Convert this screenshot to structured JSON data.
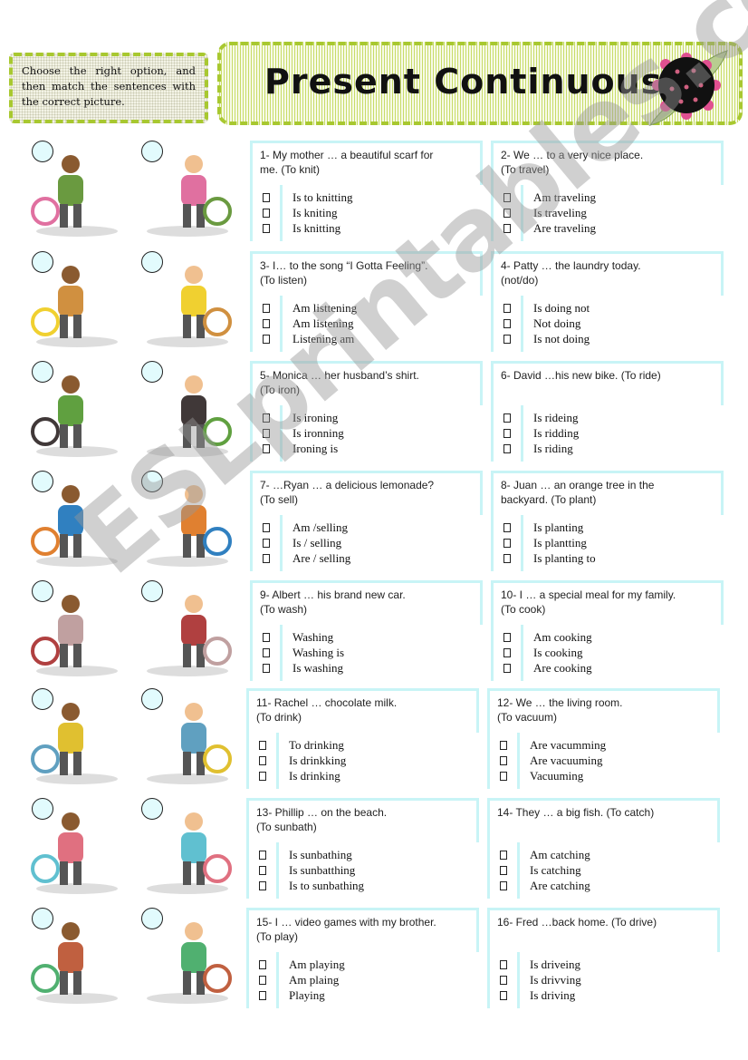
{
  "header": {
    "instructions": "Choose the right option, and then match the sentences with the correct picture.",
    "title": "Present Continuous",
    "accent_color": "#a8c830",
    "box_border_color": "#c8f4f6"
  },
  "watermark": "ESLprintables.com",
  "pictures": [
    [
      "boy-riding-bike",
      "girl-with-binoculars"
    ],
    [
      "boy-planting-tree",
      "woman-sunbathing"
    ],
    [
      "men-catching-fish",
      "boys-playing-video-games"
    ],
    [
      "boy-selling-lemonade",
      "woman-knitting"
    ],
    [
      "woman-ironing",
      "woman-vacuuming"
    ],
    [
      "laundry-basket-girl",
      "car-travel"
    ],
    [
      "woman-cooking",
      "car-with-luggage"
    ],
    [
      "boy-listening-music",
      "man-washing-car"
    ]
  ],
  "questions": [
    {
      "lines": [
        "1- My mother … a beautiful scarf for",
        "me. (To knit)"
      ],
      "options": [
        "Is to knitting",
        "Is kniting",
        "Is knitting"
      ]
    },
    {
      "lines": [
        "2-  We … to a very nice place.",
        "(To travel)"
      ],
      "options": [
        "Am traveling",
        "Is traveling",
        "Are traveling"
      ]
    },
    {
      "lines": [
        "3- I… to the song  “I Gotta Feeling”.",
        "(To listen)"
      ],
      "options": [
        "Am listtening",
        "Am listening",
        "Listening am"
      ]
    },
    {
      "lines": [
        "4- Patty … the laundry today.",
        "(not/do)"
      ],
      "options": [
        "Is doing not",
        "Not doing",
        "Is not doing"
      ]
    },
    {
      "lines": [
        "5-  Monica … her husband’s shirt.",
        "(To iron)"
      ],
      "options": [
        "Is ironing",
        "Is ironning",
        "Ironing is"
      ]
    },
    {
      "lines": [
        "6- David …his new bike. (To ride)",
        ""
      ],
      "options": [
        "Is rideing",
        "Is ridding",
        "Is riding"
      ]
    },
    {
      "lines": [
        "7- …Ryan … a delicious lemonade?",
        "(To sell)"
      ],
      "options": [
        "Am /selling",
        "Is / selling",
        "Are / selling"
      ]
    },
    {
      "lines": [
        "8- Juan … an orange tree in the",
        "backyard. (To plant)"
      ],
      "options": [
        "Is planting",
        "Is plantting",
        "Is planting to"
      ]
    },
    {
      "lines": [
        "9- Albert … his brand new car.",
        "(To wash)"
      ],
      "options": [
        "Washing",
        "Washing is",
        "Is washing"
      ]
    },
    {
      "lines": [
        "10- I … a special meal for my family.",
        "(To cook)"
      ],
      "options": [
        "Am cooking",
        "Is cooking",
        "Are cooking"
      ]
    },
    {
      "lines": [
        "11- Rachel … chocolate milk.",
        "(To drink)"
      ],
      "options": [
        "To drinking",
        "Is drinkking",
        "Is drinking"
      ]
    },
    {
      "lines": [
        "12- We … the living room.",
        "(To vacuum)"
      ],
      "options": [
        "Are vacumming",
        "Are vacuuming",
        "Vacuuming"
      ]
    },
    {
      "lines": [
        "13-  Phillip … on the beach.",
        "(To sunbath)"
      ],
      "options": [
        "Is sunbathing",
        "Is sunbatthing",
        "Is to sunbathing"
      ]
    },
    {
      "lines": [
        "14- They … a big fish. (To catch)",
        ""
      ],
      "options": [
        "Am catching",
        "Is catching",
        "Are catching"
      ]
    },
    {
      "lines": [
        "15- I … video games with my brother.",
        "(To play)"
      ],
      "options": [
        "Am playing",
        "Am plaing",
        "Playing"
      ]
    },
    {
      "lines": [
        "16- Fred …back home. (To drive)",
        ""
      ],
      "options": [
        "Is driveing",
        "Is drivving",
        "Is driving"
      ]
    }
  ]
}
